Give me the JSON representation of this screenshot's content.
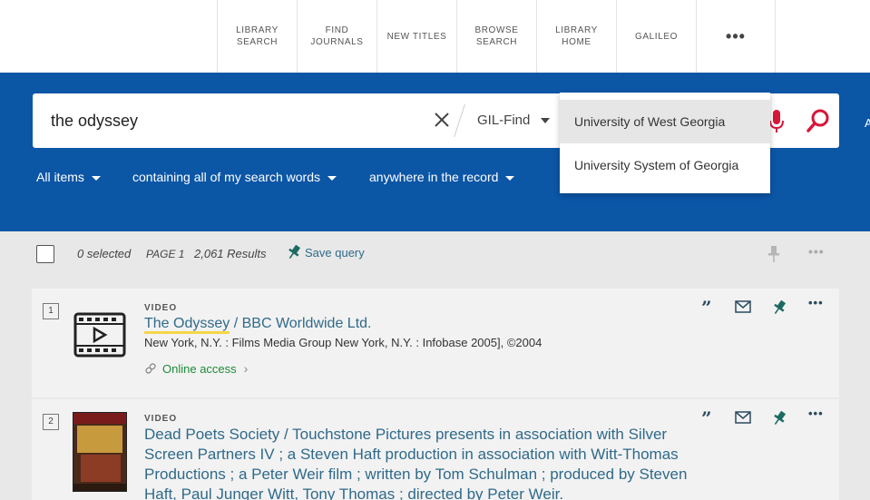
{
  "nav": {
    "items": [
      "LIBRARY SEARCH",
      "FIND JOURNALS",
      "NEW TITLES",
      "BROWSE SEARCH",
      "LIBRARY HOME",
      "GALILEO"
    ],
    "more": "•••"
  },
  "search": {
    "query": "the odyssey",
    "scope": "GIL-Find",
    "edge_char": "A"
  },
  "filters": {
    "type": "All items",
    "match": "containing all of my search words",
    "field": "anywhere in the record"
  },
  "dropdown": {
    "options": [
      "University of West Georgia",
      "University System of Georgia"
    ]
  },
  "toolbar": {
    "selected": "0 selected",
    "page": "PAGE 1",
    "results": "2,061 Results",
    "save_query": "Save query"
  },
  "results": [
    {
      "number": "1",
      "type": "VIDEO",
      "title_highlight": "The Odyssey",
      "title_rest": " / BBC Worldwide Ltd.",
      "publisher": "New York, N.Y. : Films Media Group New York, N.Y. : Infobase 2005], ©2004",
      "online_access": "Online access"
    },
    {
      "number": "2",
      "type": "VIDEO",
      "title": "Dead Poets Society / Touchstone Pictures presents in association with Silver Screen Partners IV ; a Steven Haft production in association with Witt-Thomas Productions ; a Peter Weir film ; written by Tom Schulman ; produced by Steven Haft, Paul Junger Witt, Tony Thomas ; directed by Peter Weir."
    }
  ],
  "colors": {
    "brand_blue": "#0c56a6",
    "link": "#2f6a8a",
    "online_green": "#1f8a3a",
    "mic_red": "#d6173a",
    "pin_teal": "#1b6b63",
    "highlight_yellow": "#f4d64a"
  }
}
